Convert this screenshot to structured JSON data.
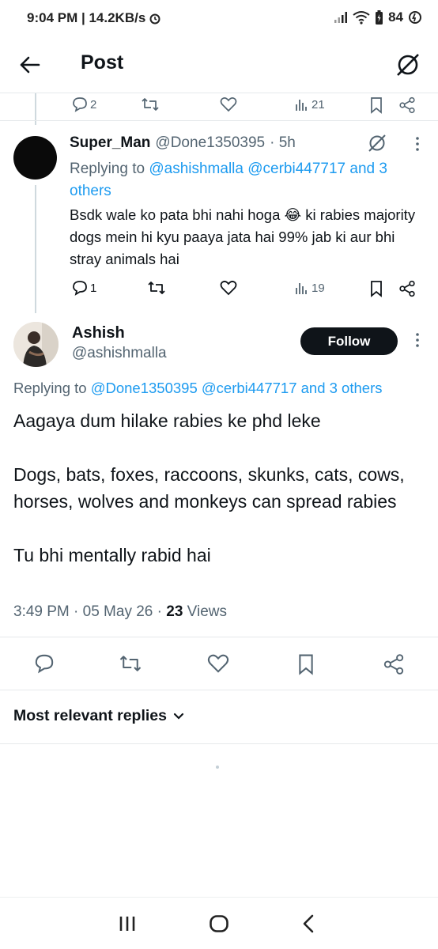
{
  "status_bar": {
    "time": "9:04 PM | 14.2KB/s",
    "battery": "84"
  },
  "app_bar": {
    "title": "Post"
  },
  "prev_tweet_actions": {
    "replies": "2",
    "views": "21"
  },
  "reply": {
    "name": "Super_Man",
    "handle": "@Done1350395",
    "time": "· 5h",
    "replying_prefix": "Replying to",
    "replying_mentions": "@ashishmalla @cerbi447717 and 3 others",
    "body": "Bsdk wale ko pata bhi nahi hoga 😂 ki rabies majority dogs mein hi kyu paaya jata hai 99% jab ki aur bhi stray animals hai",
    "replies": "1",
    "views": "19"
  },
  "main_post": {
    "name": "Ashish",
    "handle": "@ashishmalla",
    "follow_label": "Follow",
    "replying_prefix": "Replying to",
    "replying_mentions": "@Done1350395 @cerbi447717 and 3 others",
    "body_1": "Aagaya dum hilake rabies ke phd leke",
    "body_2": "Dogs, bats, foxes, raccoons, skunks, cats, cows, horses, wolves and monkeys can spread rabies",
    "body_3": "Tu bhi mentally rabid hai",
    "timestamp": "3:49 PM · 05 May 26 · ",
    "views_count": "23",
    "views_label": " Views"
  },
  "sort": {
    "label": "Most relevant replies"
  },
  "colors": {
    "accent": "#1d9bf0",
    "text": "#0f1419",
    "muted": "#536471"
  }
}
